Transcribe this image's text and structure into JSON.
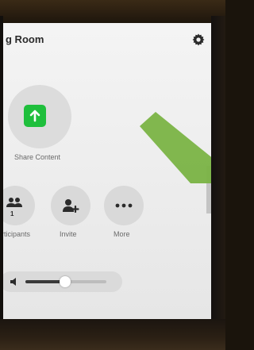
{
  "room": {
    "title": "g Room"
  },
  "header": {
    "settings_icon": "gear-icon"
  },
  "share": {
    "label": "Share Content",
    "icon": "arrow-up-icon",
    "color": "#1fbf3c"
  },
  "actions": [
    {
      "id": "participants",
      "label": "rticipants",
      "count": "1",
      "icon": "people-icon"
    },
    {
      "id": "invite",
      "label": "Invite",
      "icon": "add-person-icon"
    },
    {
      "id": "more",
      "label": "More",
      "icon": "ellipsis-icon"
    }
  ],
  "volume": {
    "icon": "speaker-icon",
    "level": 0.49
  },
  "overlay": {
    "color": "#7ab344"
  }
}
